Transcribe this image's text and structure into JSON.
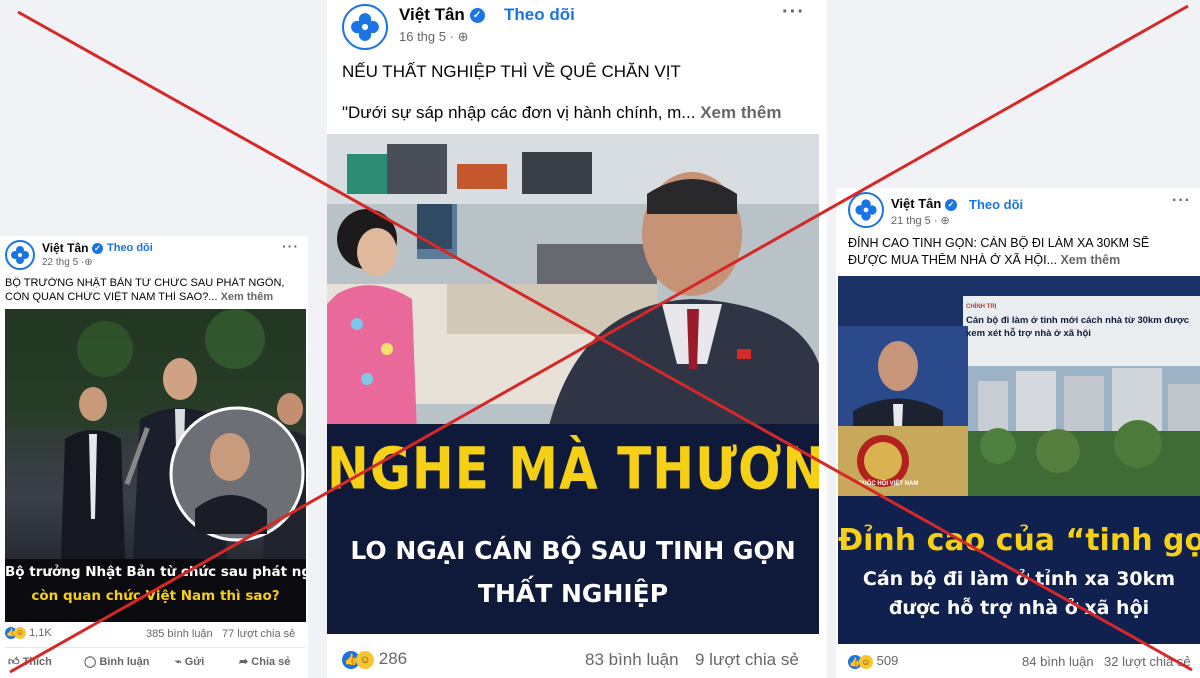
{
  "left_post": {
    "author": "Việt Tân",
    "follow": "Theo dõi",
    "date": "22 thg 5",
    "text_line1": "BỘ TRƯỞNG NHẬT BẢN TỪ CHỨC SAU PHÁT NGÔN,",
    "text_line2": "CÒN QUAN CHỨC VIỆT NAM THÌ SAO?...",
    "see_more": "Xem thêm",
    "headline_line1": "Bộ trưởng Nhật Bản từ chức sau phát ngôn,",
    "headline_line2": "còn quan chức Việt Nam thì sao?",
    "reactions": "1,1K",
    "comments": "385 bình luận",
    "shares": "77 lượt chia sẻ",
    "actions": {
      "like": "Thích",
      "comment": "Bình luận",
      "send": "Gửi",
      "share": "Chia sẻ"
    }
  },
  "center_post": {
    "author": "Việt Tân",
    "follow": "Theo dõi",
    "date": "16 thg 5",
    "title": "NẾU THẤT NGHIỆP THÌ VỀ QUÊ CHĂN VỊT",
    "text": "\"Dưới sự sáp nhập các đơn vị hành chính, m...",
    "see_more": "Xem thêm",
    "headline_line1": "NGHE MÀ THƯƠNG",
    "headline_line2": "LO NGẠI CÁN BỘ SAU TINH GỌN",
    "headline_line3": "THẤT NGHIỆP",
    "reactions": "286",
    "comments": "83 bình luận",
    "shares": "9 lượt chia sẻ"
  },
  "right_post": {
    "author": "Việt Tân",
    "follow": "Theo dõi",
    "date": "21 thg 5",
    "text_line1": "ĐỈNH CAO TINH GỌN: CÁN BỘ ĐI LÀM XA 30KM SẼ",
    "text_line2": "ĐƯỢC MUA THÊM NHÀ Ở XÃ HỘI...",
    "see_more": "Xem thêm",
    "news_label": "CHÍNH TRỊ",
    "news_title": "Cán bộ đi làm ở tỉnh mới cách nhà từ 30km được xem xét hỗ trợ nhà ở xã hội",
    "podium_text": "QUỐC HỘI VIỆT NAM",
    "headline_line1": "Đỉnh cao của “tinh gọn”",
    "headline_line2": "Cán bộ đi làm ở tỉnh xa 30km",
    "headline_line3": "được hỗ trợ nhà ở xã hội",
    "reactions": "509",
    "comments": "84 bình luận",
    "shares": "32 lượt chia sẻ"
  },
  "colors": {
    "facebook_blue": "#1b74e4",
    "cross_red": "#d62828",
    "headline_yellow": "#f5d017",
    "navy": "#0f1a3a"
  },
  "icons": [
    "avatar-logo-icon",
    "verified-badge-icon",
    "globe-icon",
    "more-options-icon",
    "like-reaction-icon",
    "haha-reaction-icon",
    "comment-icon",
    "messenger-icon",
    "share-icon",
    "like-thumb-icon"
  ]
}
